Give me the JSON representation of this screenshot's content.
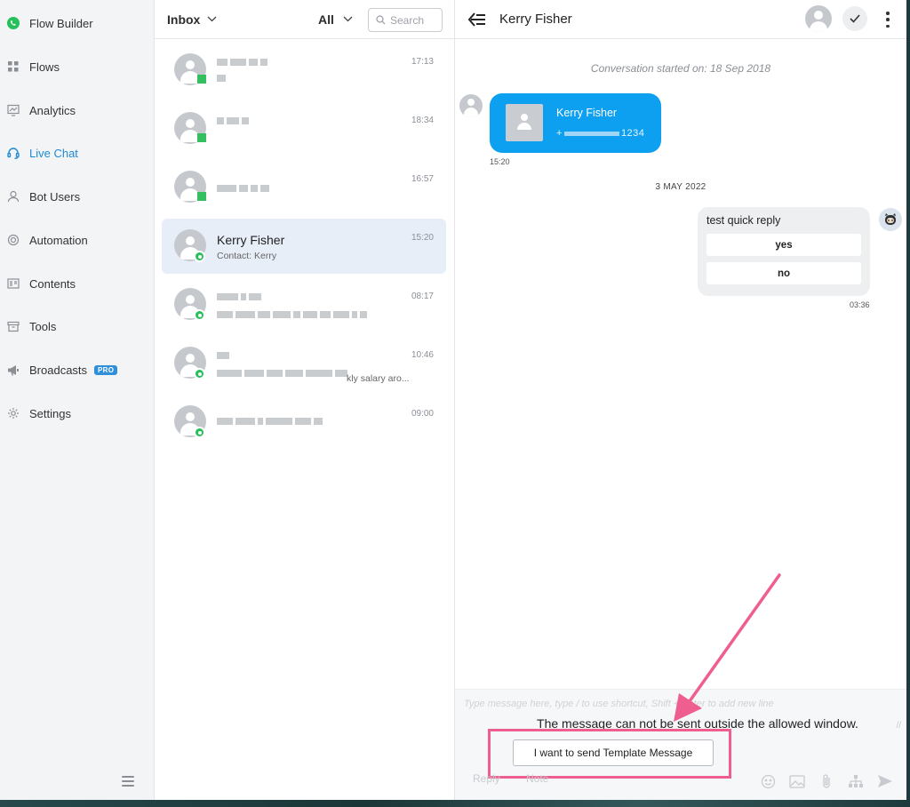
{
  "sidebar": {
    "items": [
      {
        "label": "Flow Builder",
        "icon": "whatsapp-icon",
        "active": false
      },
      {
        "label": "Flows",
        "icon": "grid-icon",
        "active": false
      },
      {
        "label": "Analytics",
        "icon": "chart-icon",
        "active": false
      },
      {
        "label": "Live Chat",
        "icon": "headset-icon",
        "active": true
      },
      {
        "label": "Bot Users",
        "icon": "user-icon",
        "active": false
      },
      {
        "label": "Automation",
        "icon": "automation-icon",
        "active": false
      },
      {
        "label": "Contents",
        "icon": "contents-icon",
        "active": false
      },
      {
        "label": "Tools",
        "icon": "toolbox-icon",
        "active": false
      },
      {
        "label": "Broadcasts",
        "icon": "megaphone-icon",
        "active": false,
        "badge": "PRO"
      },
      {
        "label": "Settings",
        "icon": "gear-icon",
        "active": false
      }
    ]
  },
  "inbox": {
    "title": "Inbox",
    "filter": "All",
    "search_placeholder": "Search",
    "conversations": [
      {
        "time": "17:13"
      },
      {
        "time": "18:34"
      },
      {
        "time": "16:57"
      },
      {
        "time": "15:20",
        "name": "Kerry Fisher",
        "subtitle": "Contact: Kerry",
        "selected": true
      },
      {
        "time": "08:17"
      },
      {
        "time": "10:46",
        "snippet": "kly salary aro..."
      },
      {
        "time": "09:00"
      }
    ]
  },
  "chat": {
    "contact_name": "Kerry Fisher",
    "conversation_started": "Conversation started on: 18 Sep 2018",
    "contact_card": {
      "name": "Kerry Fisher",
      "phone_prefix": "+",
      "phone_suffix": "1234"
    },
    "contact_card_time": "15:20",
    "date_separator": "3 MAY 2022",
    "quick_reply": {
      "text": "test quick reply",
      "options": [
        "yes",
        "no"
      ],
      "time": "03:36"
    },
    "composer": {
      "placeholder": "Type message here, type / to use shortcut, Shift + Enter to add new line",
      "window_message": "The message can not be sent outside the allowed window.",
      "template_button": "I want to send Template Message",
      "tab_reply": "Reply",
      "tab_note": "Note"
    }
  },
  "colors": {
    "accent": "#1f8ad0",
    "bubble_blue": "#0ea0f0",
    "highlight": "#ee5f8f",
    "whatsapp": "#25c05a"
  }
}
